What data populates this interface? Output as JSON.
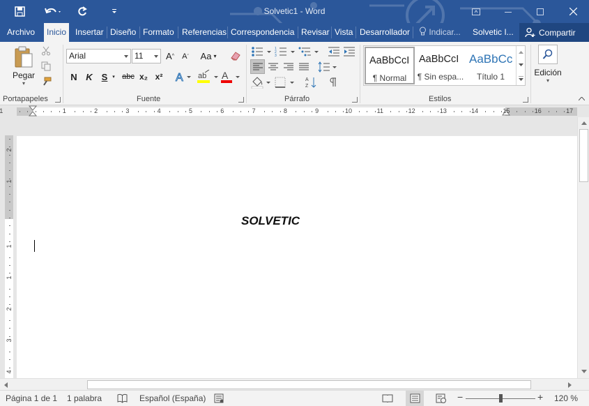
{
  "window": {
    "title": "Solvetic1 - Word",
    "brand_color": "#2b579a"
  },
  "quick_access": {
    "save_icon": "save-icon",
    "undo_icon": "undo-icon",
    "redo_icon": "redo-icon",
    "customize_icon": "customize-qat-icon"
  },
  "tabs": [
    {
      "label": "Archivo"
    },
    {
      "label": "Inicio",
      "active": true
    },
    {
      "label": "Insertar"
    },
    {
      "label": "Diseño"
    },
    {
      "label": "Formato"
    },
    {
      "label": "Referencias"
    },
    {
      "label": "Correspondencia"
    },
    {
      "label": "Revisar"
    },
    {
      "label": "Vista"
    },
    {
      "label": "Desarrollador"
    }
  ],
  "tell_me": "Indicar...",
  "account": "Solvetic I...",
  "share_label": "Compartir",
  "ribbon": {
    "clipboard": {
      "label": "Portapapeles",
      "paste_label": "Pegar"
    },
    "font": {
      "label": "Fuente",
      "font_name": "Arial",
      "font_size": "11",
      "bold": "N",
      "italic": "K",
      "underline": "S",
      "strike": "abc",
      "subscript": "x₂",
      "superscript": "x²",
      "grow": "A",
      "shrink": "A",
      "change_case": "Aa"
    },
    "paragraph": {
      "label": "Párrafo"
    },
    "styles": {
      "label": "Estilos",
      "items": [
        {
          "sample": "AaBbCcI",
          "name": "¶ Normal",
          "selected": true
        },
        {
          "sample": "AaBbCcI",
          "name": "¶ Sin espa..."
        },
        {
          "sample": "AaBbCc",
          "name": "Título 1",
          "color": "#2e74b5"
        }
      ]
    },
    "editing": {
      "label": "Edición"
    }
  },
  "ruler": {
    "numbers": [
      "1",
      "1",
      "2",
      "3",
      "4",
      "5",
      "6",
      "7",
      "8",
      "9",
      "10",
      "11",
      "12",
      "13",
      "14",
      "15",
      "16",
      "17"
    ],
    "vnumbers": [
      "2",
      "1",
      "1",
      "1",
      "2",
      "3",
      "4",
      "5"
    ]
  },
  "document": {
    "title_text": "SOLVETIC"
  },
  "status": {
    "page": "Página 1 de 1",
    "words": "1 palabra",
    "language": "Español (España)",
    "zoom": "120 %",
    "zoom_value": 120
  }
}
